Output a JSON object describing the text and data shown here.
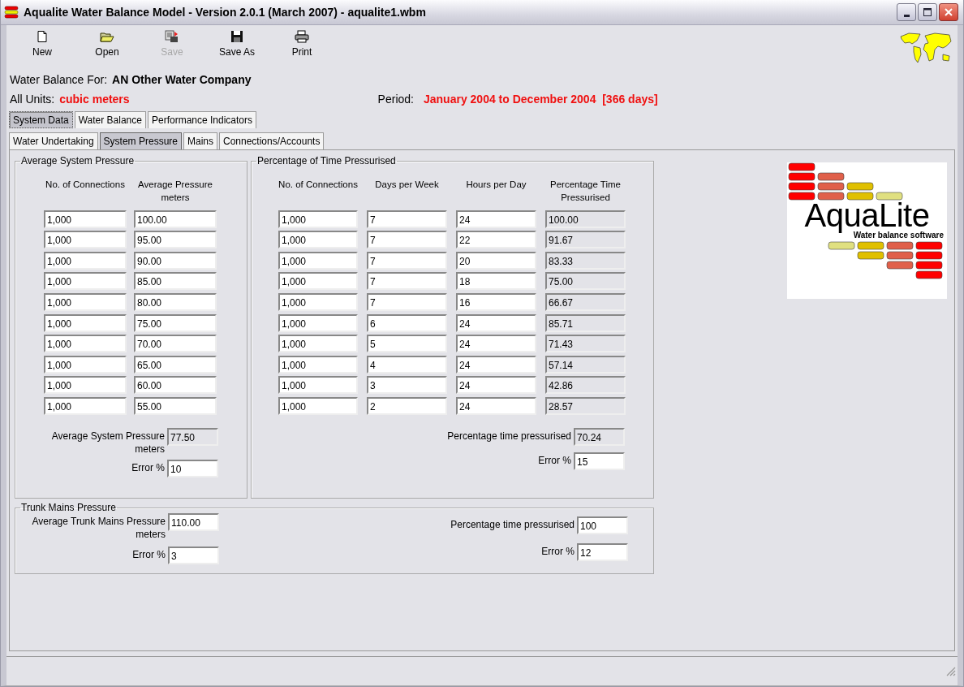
{
  "window": {
    "title": "Aqualite Water Balance Model - Version 2.0.1 (March 2007) - aqualite1.wbm"
  },
  "toolbar": [
    {
      "label": "New",
      "kind": "new",
      "disabled": false
    },
    {
      "label": "Open",
      "kind": "open",
      "disabled": false
    },
    {
      "label": "Save",
      "kind": "save",
      "disabled": true
    },
    {
      "label": "Save As",
      "kind": "saveas",
      "disabled": false
    },
    {
      "label": "Print",
      "kind": "print",
      "disabled": false
    }
  ],
  "water_balance_for": {
    "label": "Water Balance For:",
    "value": "AN Other Water Company"
  },
  "units": {
    "label": "All Units:",
    "value": "cubic meters"
  },
  "period": {
    "label": "Period:",
    "value": "January 2004 to December 2004  [366 days]"
  },
  "tabs": [
    {
      "label": "System Data",
      "selected": true
    },
    {
      "label": "Water Balance",
      "selected": false
    },
    {
      "label": "Performance Indicators",
      "selected": false
    }
  ],
  "subtabs": [
    {
      "label": "Water Undertaking",
      "selected": false
    },
    {
      "label": "System Pressure",
      "selected": true
    },
    {
      "label": "Mains",
      "selected": false
    },
    {
      "label": "Connections/Accounts",
      "selected": false
    }
  ],
  "average_system_pressure": {
    "title": "Average System Pressure",
    "columns": [
      {
        "label": "No. of Connections",
        "readonly": false
      },
      {
        "label": "Average Pressure",
        "unit": "meters",
        "readonly": false
      }
    ],
    "rows": [
      [
        "1,000",
        "100.00"
      ],
      [
        "1,000",
        "95.00"
      ],
      [
        "1,000",
        "90.00"
      ],
      [
        "1,000",
        "85.00"
      ],
      [
        "1,000",
        "80.00"
      ],
      [
        "1,000",
        "75.00"
      ],
      [
        "1,000",
        "70.00"
      ],
      [
        "1,000",
        "65.00"
      ],
      [
        "1,000",
        "60.00"
      ],
      [
        "1,000",
        "55.00"
      ]
    ],
    "results": [
      {
        "label": "Average System Pressure",
        "unit": "meters",
        "value": "77.50",
        "readonly": true
      },
      {
        "label": "Error %",
        "value": "10",
        "readonly": false
      }
    ]
  },
  "percentage_time_pressurised": {
    "title": "Percentage of Time Pressurised",
    "columns": [
      {
        "label": "No. of Connections",
        "readonly": false
      },
      {
        "label": "Days per Week",
        "readonly": false
      },
      {
        "label": "Hours per Day",
        "readonly": false
      },
      {
        "label": "Percentage Time Pressurised",
        "readonly": true
      }
    ],
    "rows": [
      [
        "1,000",
        "7",
        "24",
        "100.00"
      ],
      [
        "1,000",
        "7",
        "22",
        "91.67"
      ],
      [
        "1,000",
        "7",
        "20",
        "83.33"
      ],
      [
        "1,000",
        "7",
        "18",
        "75.00"
      ],
      [
        "1,000",
        "7",
        "16",
        "66.67"
      ],
      [
        "1,000",
        "6",
        "24",
        "85.71"
      ],
      [
        "1,000",
        "5",
        "24",
        "71.43"
      ],
      [
        "1,000",
        "4",
        "24",
        "57.14"
      ],
      [
        "1,000",
        "3",
        "24",
        "42.86"
      ],
      [
        "1,000",
        "2",
        "24",
        "28.57"
      ]
    ],
    "results": [
      {
        "label": "Percentage time pressurised",
        "value": "70.24",
        "readonly": true
      },
      {
        "label": "Error %",
        "value": "15",
        "readonly": false
      }
    ]
  },
  "trunk_mains_pressure": {
    "title": "Trunk Mains Pressure",
    "left": [
      {
        "label": "Average Trunk Mains Pressure",
        "unit": "meters",
        "value": "110.00",
        "readonly": false
      },
      {
        "label": "Error %",
        "value": "3",
        "readonly": false
      }
    ],
    "right": [
      {
        "label": "Percentage time pressurised",
        "value": "100",
        "readonly": false
      },
      {
        "label": "Error %",
        "value": "12",
        "readonly": false
      }
    ]
  },
  "logo": {
    "name": "AquaLite",
    "tagline": "Water balance software"
  }
}
